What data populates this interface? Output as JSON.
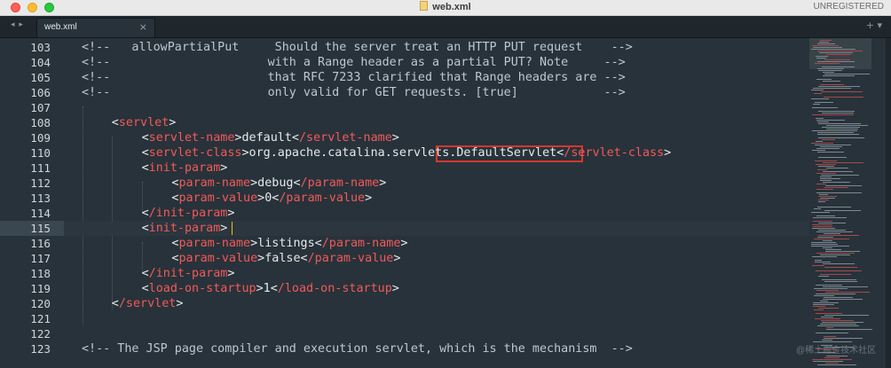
{
  "window": {
    "title": "web.xml",
    "badge": "UNREGISTERED"
  },
  "tabbar": {
    "nav": "◂ ▸",
    "tabs": [
      {
        "label": "web.xml",
        "close": "×",
        "active": true
      }
    ],
    "controls": "+ ▾"
  },
  "editor": {
    "current_line": "115",
    "lines": [
      {
        "num": "103",
        "text": "<!--   allowPartialPut     Should the server treat an HTTP PUT request    -->"
      },
      {
        "num": "104",
        "text": "<!--                      with a Range header as a partial PUT? Note     -->"
      },
      {
        "num": "105",
        "text": "<!--                      that RFC 7233 clarified that Range headers are -->"
      },
      {
        "num": "106",
        "text": "<!--                      only valid for GET requests. [true]            -->"
      },
      {
        "num": "107",
        "text": ""
      },
      {
        "num": "108",
        "text": "<servlet>"
      },
      {
        "num": "109",
        "text": "<servlet-name>default</servlet-name>"
      },
      {
        "num": "110",
        "text": "<servlet-class>org.apache.catalina.servlets.DefaultServlet</servlet-class>"
      },
      {
        "num": "111",
        "text": "<init-param>"
      },
      {
        "num": "112",
        "text": "<param-name>debug</param-name>"
      },
      {
        "num": "113",
        "text": "<param-value>0</param-value>"
      },
      {
        "num": "114",
        "text": "</init-param>"
      },
      {
        "num": "115",
        "text": "<init-param>"
      },
      {
        "num": "116",
        "text": "<param-name>listings</param-name>"
      },
      {
        "num": "117",
        "text": "<param-value>false</param-value>"
      },
      {
        "num": "118",
        "text": "</init-param>"
      },
      {
        "num": "119",
        "text": "<load-on-startup>1</load-on-startup>"
      },
      {
        "num": "120",
        "text": "</servlet>"
      },
      {
        "num": "121",
        "text": ""
      },
      {
        "num": "122",
        "text": ""
      },
      {
        "num": "123",
        "text": "<!-- The JSP page compiler and execution servlet, which is the mechanism  -->"
      }
    ]
  },
  "colors": {
    "background": "#28323a",
    "tag": "#f25a5a",
    "plain": "#e5e9ec",
    "comment": "#bfc7cf",
    "highlight_box": "#d6362b",
    "caret": "#f1c500"
  },
  "watermark": "@稀土掘金技术社区"
}
